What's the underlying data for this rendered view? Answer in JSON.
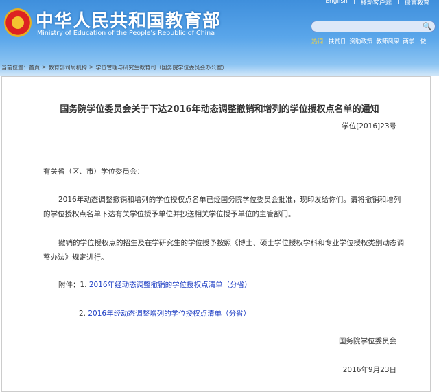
{
  "header": {
    "title_cn": "中华人民共和国教育部",
    "title_en": "Ministry of Education of the People's Republic of China",
    "top_links": [
      "English",
      "|",
      "移动客户端",
      "|",
      "微言教育"
    ],
    "hot_label": "热词:",
    "hot_words": [
      "扶贫日",
      "资助政策",
      "教师风采",
      "两学一做"
    ]
  },
  "breadcrumb": [
    "当前位置：首页",
    ">",
    "教育部司局机构",
    ">",
    "学位管理与研究生教育司（国务院学位委员会办公室）"
  ],
  "doc": {
    "title": "国务院学位委员会关于下达2016年动态调整撤销和增列的学位授权点名单的通知",
    "number": "学位[2016]23号",
    "salutation": "有关省（区、市）学位委员会：",
    "para1_a": "2016年动态调整撤销和增列的学位授权点名单已经国务院学位委员会批准，现印发给你们。请将撤销和增列",
    "para1_b": "的学位授权点名单下达有关学位授予单位并抄送相关学位授予单位的主管部门。",
    "para2_a": "撤销的学位授权点的招生及在学研究生的学位授予按照《博士、硕士学位授权学科和专业学位授权类别动态调",
    "para2_b": "整办法》规定进行。",
    "attach_label": "附件：1.",
    "attach1": "2016年经动态调整撤销的学位授权点清单（分省）",
    "attach2_num": "2.",
    "attach2": "2016年经动态调整增列的学位授权点清单（分省）",
    "signer": "国务院学位委员会",
    "date": "2016年9月23日"
  }
}
